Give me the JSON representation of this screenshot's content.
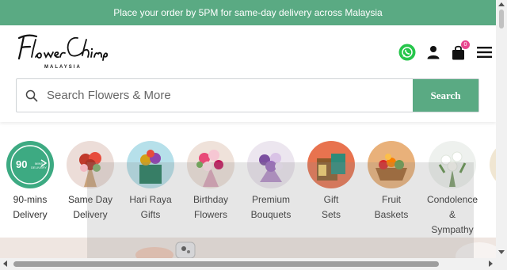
{
  "theme": {
    "accent": "#5aaa83"
  },
  "announcement": "Place your order by 5PM for same-day delivery across Malaysia",
  "logo": {
    "text": "FlowerChimp",
    "subtext": "MALAYSIA"
  },
  "header_icons": [
    {
      "name": "whatsapp-icon"
    },
    {
      "name": "user-icon"
    },
    {
      "name": "cart-icon",
      "badge": "0"
    },
    {
      "name": "menu-icon"
    }
  ],
  "search": {
    "placeholder": "Search Flowers & More",
    "button_label": "Search"
  },
  "categories": [
    {
      "label": "90-mins Delivery",
      "line1": "90-mins",
      "line2": "Delivery",
      "badge": "90",
      "badge_sub": "MINS DELIVERY"
    },
    {
      "line1": "Same Day",
      "line2": "Delivery"
    },
    {
      "line1": "Hari Raya",
      "line2": "Gifts"
    },
    {
      "line1": "Birthday",
      "line2": "Flowers"
    },
    {
      "line1": "Premium",
      "line2": "Bouquets"
    },
    {
      "line1": "Gift",
      "line2": "Sets"
    },
    {
      "line1": "Fruit",
      "line2": "Baskets"
    },
    {
      "line1": "Condolence",
      "line2": "&",
      "line3": "Sympathy"
    }
  ]
}
